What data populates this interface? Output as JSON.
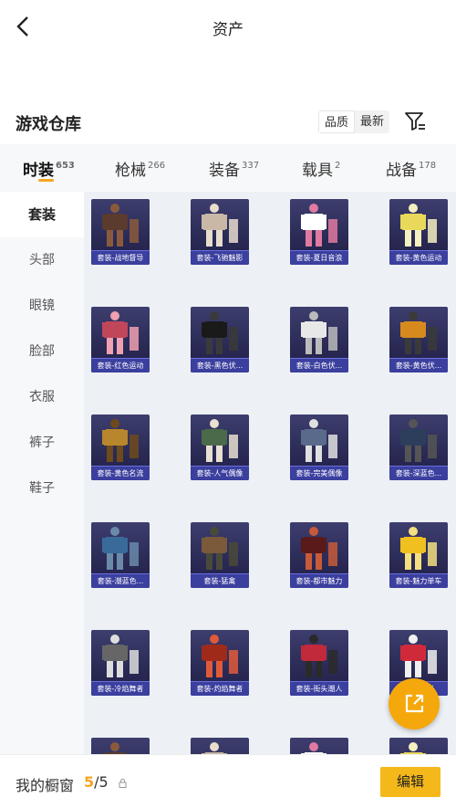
{
  "header": {
    "title": "资产"
  },
  "warehouse": {
    "title": "游戏仓库",
    "sort_quality": "品质",
    "sort_latest": "最新"
  },
  "tabs": [
    {
      "label": "时装",
      "count": "653"
    },
    {
      "label": "枪械",
      "count": "266"
    },
    {
      "label": "装备",
      "count": "337"
    },
    {
      "label": "载具",
      "count": "2"
    },
    {
      "label": "战备",
      "count": "178"
    }
  ],
  "sidebar": {
    "items": [
      "套装",
      "头部",
      "眼镜",
      "脸部",
      "衣服",
      "裤子",
      "鞋子"
    ]
  },
  "items": [
    "套装-战地督导",
    "套装-飞驰魅影",
    "套装-夏日音浪",
    "套装-黄色运动",
    "套装-红色运动",
    "套装-黑色伏...",
    "套装-白色伏...",
    "套装-黄色伏...",
    "套装-黄色名流",
    "套装-人气偶像",
    "套装-完美偶像",
    "套装-深蓝色...",
    "套装-潮蓝色...",
    "套装-猛禽",
    "套装-都市魅力",
    "套装-魅力单车",
    "套装-冷焰舞者",
    "套装-灼焰舞者",
    "套装-街头潮人",
    "套装-...光"
  ],
  "bottom": {
    "label": "我的橱窗",
    "current": "5",
    "total": "/5",
    "edit_label": "编辑"
  },
  "colors": {
    "accent": "#f5a623",
    "card_label_bg": "#3b3f9e"
  },
  "icons": {
    "back": "chevron-left-icon",
    "filter": "filter-icon",
    "share": "share-external-icon",
    "lock": "lock-icon"
  }
}
